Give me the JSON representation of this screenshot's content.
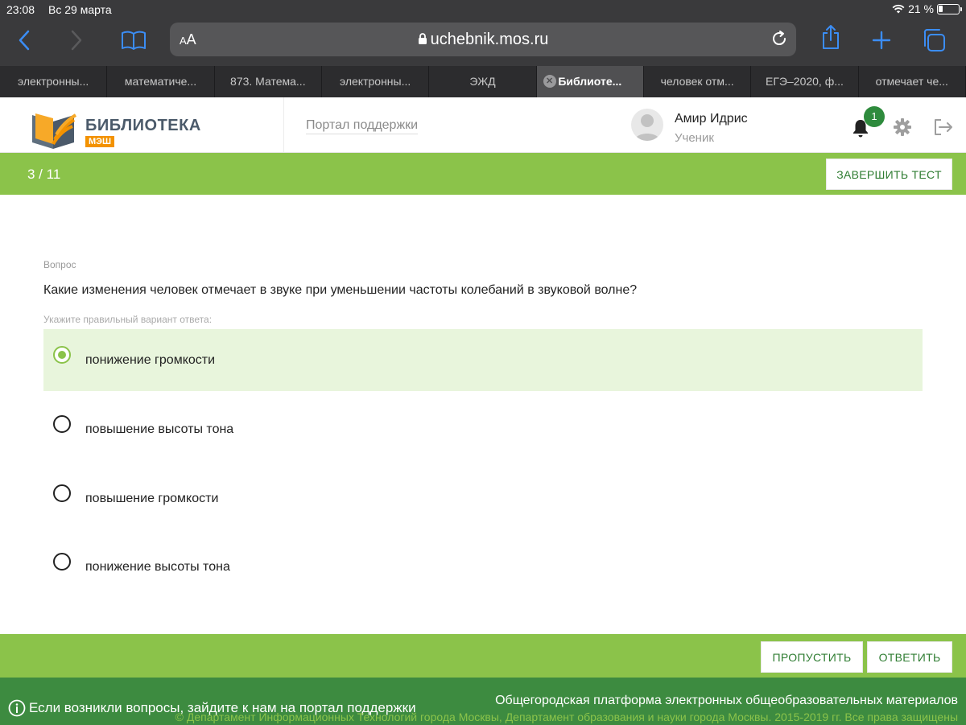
{
  "status_bar": {
    "time": "23:08",
    "date": "Вс 29 марта",
    "battery": "21 %"
  },
  "browser": {
    "font_size_label": "AA",
    "url": "uchebnik.mos.ru",
    "tabs": [
      {
        "label": "электронны...",
        "active": false
      },
      {
        "label": "математиче...",
        "active": false
      },
      {
        "label": "873. Матема...",
        "active": false
      },
      {
        "label": "электронны...",
        "active": false
      },
      {
        "label": "ЭЖД",
        "active": false
      },
      {
        "label": "Библиоте...",
        "active": true
      },
      {
        "label": "человек отм...",
        "active": false
      },
      {
        "label": "ЕГЭ–2020, ф...",
        "active": false
      },
      {
        "label": "отмечает че...",
        "active": false
      }
    ],
    "accent_color": "#3b8df5"
  },
  "header": {
    "logo_title": "БИБЛИОТЕКА",
    "logo_sub": "МЭШ",
    "support_link": "Портал поддержки",
    "user_name": "Амир Идрис",
    "user_role": "Ученик",
    "notifications_count": "1"
  },
  "progress": {
    "counter": "3 / 11",
    "finish_label": "ЗАВЕРШИТЬ ТЕСТ"
  },
  "question": {
    "label": "Вопрос",
    "text": "Какие изменения человек отмечает в звуке при уменьшении частоты колебаний в звуковой волне?",
    "hint": "Укажите правильный вариант ответа:",
    "options": [
      {
        "text": "понижение громкости",
        "selected": true
      },
      {
        "text": "повышение высоты тона",
        "selected": false
      },
      {
        "text": "повышение громкости",
        "selected": false
      },
      {
        "text": "понижение высоты тона",
        "selected": false
      }
    ]
  },
  "actions": {
    "skip_label": "ПРОПУСТИТЬ",
    "answer_label": "ОТВЕТИТЬ"
  },
  "footer": {
    "help_text": "Если возникли вопросы, зайдите к нам на портал поддержки",
    "platform_text": "Общегородская платформа электронных общеобразовательных материалов",
    "copyright": "© Департамент Информационных Технологий города Москвы, Департамент образования и науки города Москвы. 2015-2019 гг. Все права защищены"
  },
  "colors": {
    "green": "#8bc34a",
    "dark_green": "#3d8b40",
    "selected_bg": "#e8f5dc"
  }
}
